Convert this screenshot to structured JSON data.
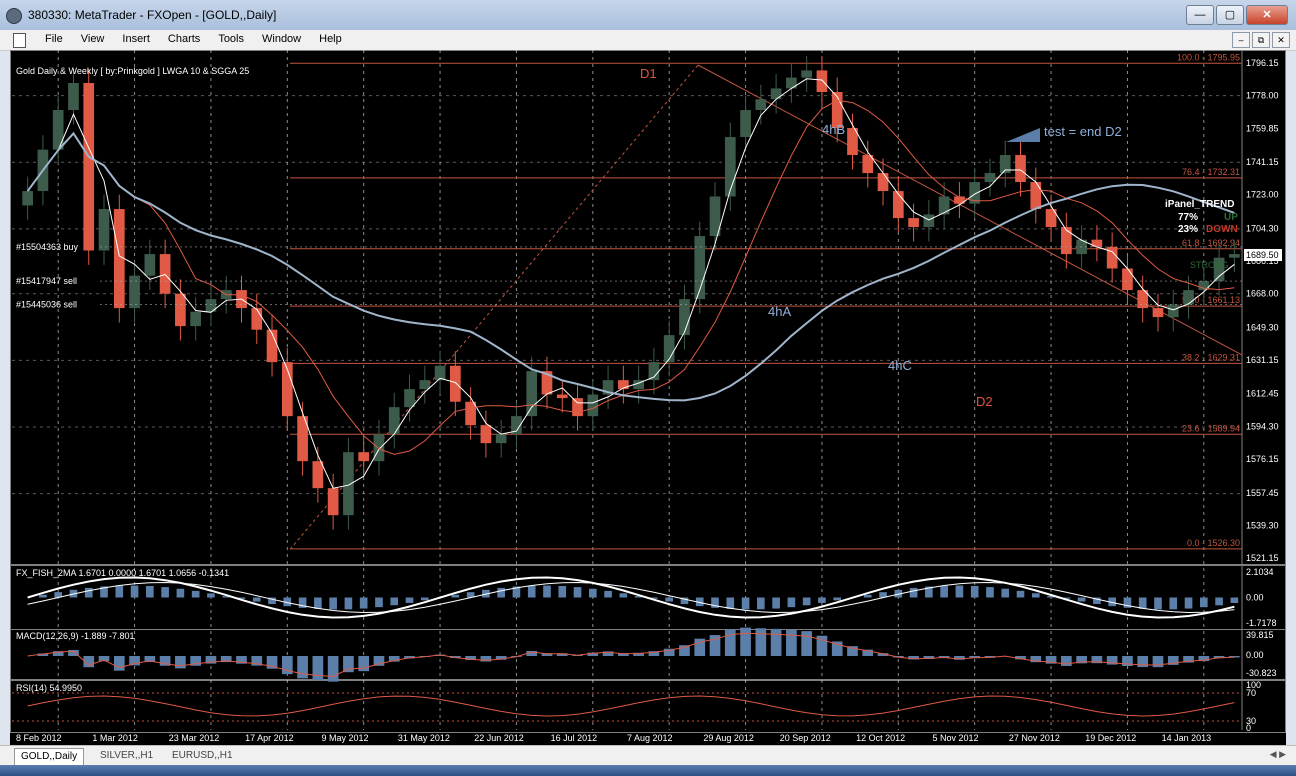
{
  "window": {
    "title": "380330: MetaTrader - FXOpen - [GOLD,,Daily]",
    "minimize": "—",
    "maximize": "▢",
    "close": "✕"
  },
  "menu": {
    "items": [
      "File",
      "View",
      "Insert",
      "Charts",
      "Tools",
      "Window",
      "Help"
    ],
    "mdi_min": "–",
    "mdi_restore": "⧉",
    "mdi_close": "✕"
  },
  "chart": {
    "header": "Gold Daily & Weekly [ by:Prinkgold ] LWGA 10  &  SGGA 25",
    "current_price": "1689.50",
    "price_axis": [
      "1796.15",
      "1778.00",
      "1759.85",
      "1741.15",
      "1723.00",
      "1704.30",
      "1686.15",
      "1668.00",
      "1649.30",
      "1631.15",
      "1612.45",
      "1594.30",
      "1576.15",
      "1557.45",
      "1539.30",
      "1521.15"
    ],
    "fib_levels": [
      {
        "label": "100.0 - 1795.95",
        "price": 1795.95
      },
      {
        "label": "76.4 - 1732.31",
        "price": 1732.31
      },
      {
        "label": "61.8 - 1692.94",
        "price": 1692.94
      },
      {
        "label": "50.0 - 1661.13",
        "price": 1661.13
      },
      {
        "label": "38.2 - 1629.31",
        "price": 1629.31
      },
      {
        "label": "23.6 - 1589.94",
        "price": 1589.94
      },
      {
        "label": "0.0 - 1526.30",
        "price": 1526.3
      }
    ],
    "annotations": [
      {
        "text": "D1",
        "color": "#e0553f"
      },
      {
        "text": "4hB",
        "color": "#8fb0d8"
      },
      {
        "text": "4hA",
        "color": "#8fb0d8"
      },
      {
        "text": "4hC",
        "color": "#8fb0d8"
      },
      {
        "text": "D2",
        "color": "#e0553f"
      },
      {
        "text": "test = end D2",
        "color": "#8fb0d8"
      }
    ],
    "orders": [
      "#15504363 buy",
      "#15417947 sell",
      "#15445036 sell"
    ],
    "ipanel": {
      "title": "iPanel_TREND",
      "up_pct": "77%",
      "up_label": "UP",
      "down_pct": "23%",
      "down_label": "DOWN",
      "strong": "STRONG"
    },
    "dates": [
      "8 Feb 2012",
      "1 Mar 2012",
      "23 Mar 2012",
      "17 Apr 2012",
      "9 May 2012",
      "31 May 2012",
      "22 Jun 2012",
      "16 Jul 2012",
      "7 Aug 2012",
      "29 Aug 2012",
      "20 Sep 2012",
      "12 Oct 2012",
      "5 Nov 2012",
      "27 Nov 2012",
      "19 Dec 2012",
      "14 Jan 2013"
    ]
  },
  "indicators": {
    "fisher": {
      "label": "FX_FISH_2MA 1.6701 0.0000 1.6701 1.0656 -0.1341",
      "ticks": [
        "2.1034",
        "0.00",
        "-1.7178"
      ]
    },
    "macd": {
      "label": "MACD(12,26,9) -1.889 -7.801",
      "ticks": [
        "39.815",
        "0.00",
        "-30.823"
      ]
    },
    "rsi": {
      "label": "RSI(14) 54.9950",
      "ticks": [
        "100",
        "70",
        "30",
        "0"
      ]
    }
  },
  "tabs": [
    "GOLD,,Daily",
    "SILVER,,H1",
    "EURUSD,,H1"
  ],
  "colors": {
    "bull": "#3d5b4a",
    "bear": "#e05a45",
    "fib": "#c2553f",
    "ma_slow": "#9fb5cc"
  },
  "chart_data": {
    "type": "candlestick",
    "close_series": [
      1725,
      1748,
      1770,
      1785,
      1692,
      1715,
      1660,
      1678,
      1690,
      1668,
      1650,
      1658,
      1665,
      1670,
      1660,
      1648,
      1630,
      1600,
      1575,
      1560,
      1545,
      1580,
      1575,
      1590,
      1605,
      1615,
      1620,
      1628,
      1608,
      1595,
      1585,
      1590,
      1600,
      1625,
      1612,
      1610,
      1600,
      1612,
      1620,
      1615,
      1620,
      1630,
      1645,
      1665,
      1700,
      1722,
      1755,
      1770,
      1776,
      1782,
      1788,
      1792,
      1780,
      1760,
      1745,
      1735,
      1725,
      1710,
      1705,
      1712,
      1722,
      1718,
      1730,
      1735,
      1745,
      1730,
      1715,
      1705,
      1690,
      1698,
      1694,
      1682,
      1670,
      1660,
      1655,
      1662,
      1670,
      1675,
      1688,
      1690
    ]
  }
}
